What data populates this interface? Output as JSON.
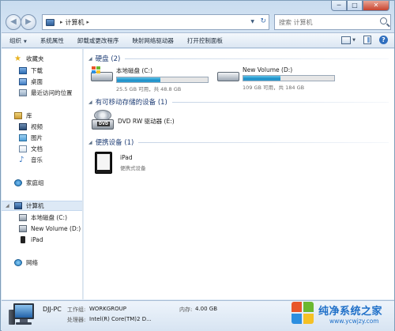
{
  "window": {
    "caption": {
      "minimize": "─",
      "maximize": "□",
      "close": "✕"
    }
  },
  "navigation": {
    "back_glyph": "◀",
    "forward_glyph": "▶",
    "history_glyph": "▼"
  },
  "address": {
    "separator_1": "▸",
    "location": "计算机",
    "separator_2": "▸",
    "dropdown_glyph": "▼",
    "refresh_glyph": "↻"
  },
  "search": {
    "placeholder": "搜索 计算机"
  },
  "toolbar": {
    "organize": "组织",
    "organize_drop": "▼",
    "system_properties": "系统属性",
    "uninstall": "卸载或更改程序",
    "map_drive": "映射网络驱动器",
    "control_panel": "打开控制面板",
    "views_drop": "▼",
    "help": "?"
  },
  "sidebar": {
    "favorites": "收藏夹",
    "downloads": "下载",
    "desktop": "桌面",
    "recent": "最近访问的位置",
    "libraries": "库",
    "videos": "视频",
    "pictures": "图片",
    "documents": "文档",
    "music": "音乐",
    "homegroup": "家庭组",
    "computer": "计算机",
    "local_disk": "本地磁盘 (C:)",
    "new_volume": "New Volume (D:)",
    "ipad": "iPad",
    "network": "网络",
    "expand_glyph": "◢",
    "star_glyph": "★",
    "music_glyph": "♪"
  },
  "content": {
    "group_hdd": "硬盘 (2)",
    "group_removable": "有可移动存储的设备 (1)",
    "group_portable": "便携设备 (1)",
    "group_arrow": "◢",
    "drive_c": {
      "name": "本地磁盘 (C:)",
      "stat": "25.5 GB 可用，共 48.8 GB",
      "used_fraction": 0.48
    },
    "drive_d": {
      "name": "New Volume (D:)",
      "stat": "109 GB 可用，共 184 GB",
      "used_fraction": 0.41
    },
    "dvd": {
      "name": "DVD RW 驱动器 (E:)",
      "badge": "DVD"
    },
    "ipad": {
      "name": "iPad",
      "type": "便携式设备"
    }
  },
  "details": {
    "pc_name": "DJJ-PC",
    "workgroup_label": "工作组:",
    "workgroup_value": "WORKGROUP",
    "memory_label": "内存:",
    "memory_value": "4.00 GB",
    "processor_label": "处理器:",
    "processor_value": "Intel(R) Core(TM)2 D..."
  },
  "watermark": {
    "title": "纯净系统之家",
    "url": "www.ycwjzy.com"
  },
  "colors": {
    "accent_blue": "#1e6fc8",
    "bar_fill": "#2b9fd4",
    "header_text": "#1e3d75"
  }
}
